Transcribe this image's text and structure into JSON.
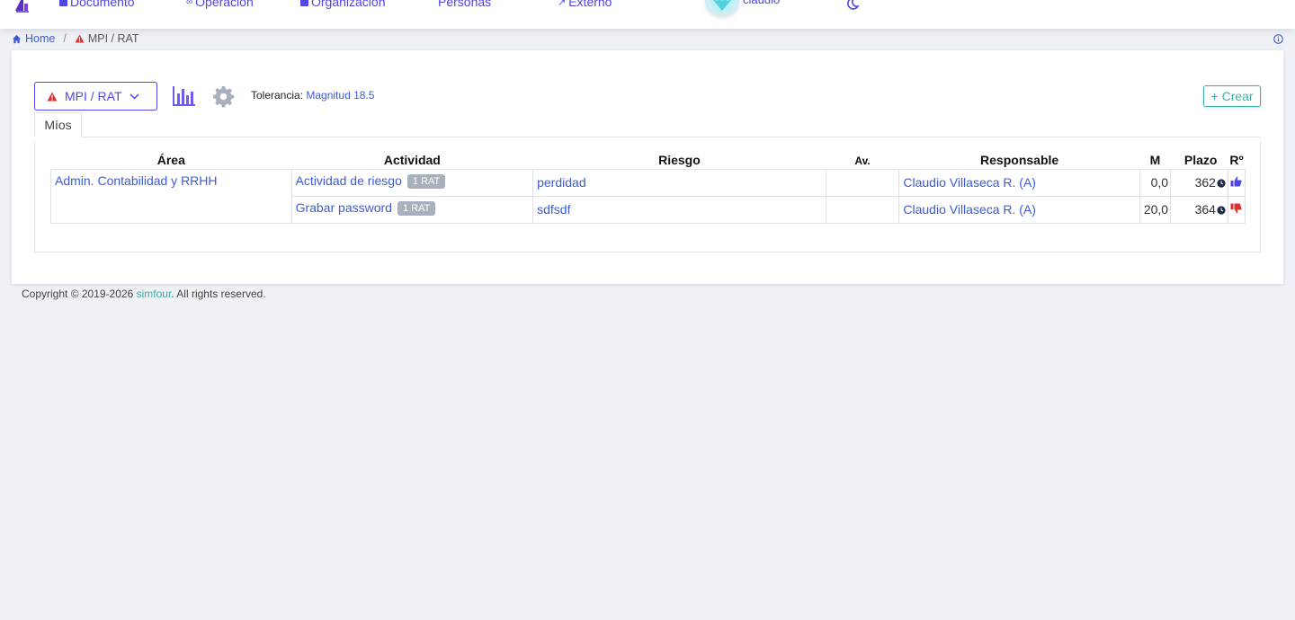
{
  "nav": {
    "items": [
      {
        "label": "Documento"
      },
      {
        "label": "Operación"
      },
      {
        "label": "Organización"
      },
      {
        "label": "Personas"
      },
      {
        "label": "Externo"
      }
    ],
    "user_name": "claudio"
  },
  "breadcrumb": {
    "home": "Home",
    "separator": "/",
    "current": "MPI / RAT"
  },
  "toolbar": {
    "module_label": "MPI / RAT",
    "tolerance_label": "Tolerancia:",
    "tolerance_value": "Magnitud 18.5",
    "create_label": "Crear"
  },
  "tabs": [
    {
      "label": "Míos"
    }
  ],
  "table": {
    "headers": [
      "Área",
      "Actividad",
      "Riesgo",
      "Av.",
      "Responsable",
      "M",
      "Plazo",
      "Rº"
    ],
    "area": "Admin. Contabilidad y RRHH",
    "rows": [
      {
        "activity": "Actividad de riesgo",
        "badge": "1 RAT",
        "risk": "perdidad",
        "av": "",
        "responsible": "Claudio Villaseca R. (A)",
        "m": "0,0",
        "plazo": "362",
        "status": "thumbs-up"
      },
      {
        "activity": "Grabar password",
        "badge": "1 RAT",
        "risk": "sdfsdf",
        "av": "",
        "responsible": "Claudio Villaseca R. (A)",
        "m": "20,0",
        "plazo": "364",
        "status": "thumbs-down"
      }
    ]
  },
  "footer": {
    "prefix": "Copyright © 2019-2026 ",
    "brand": "simfour",
    "suffix": ". All rights reserved."
  },
  "colors": {
    "primary": "#4f46e5",
    "link": "#3b5bdb",
    "accent": "#38b2ac",
    "danger": "#e03131",
    "badge": "#a9b0bd"
  },
  "icons": [
    "home-icon",
    "warning-icon",
    "chevron-down-icon",
    "bar-chart-icon",
    "gear-icon",
    "plus-icon",
    "clock-icon",
    "thumbs-up-icon",
    "thumbs-down-icon",
    "info-icon",
    "moon-icon"
  ]
}
